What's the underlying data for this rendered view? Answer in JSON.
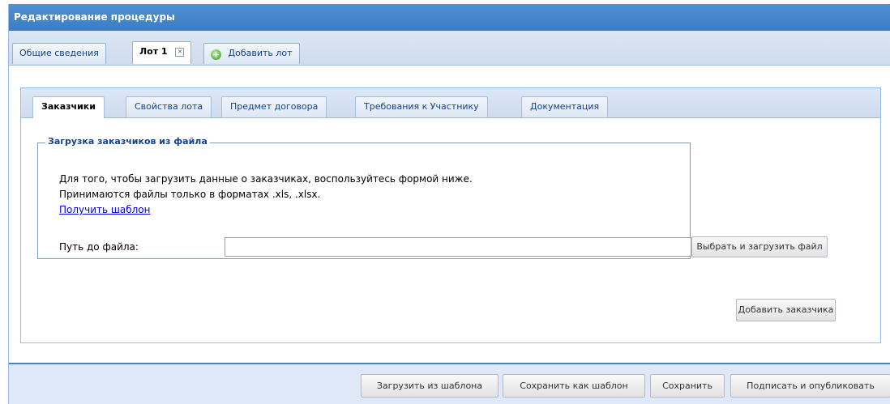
{
  "window": {
    "title": "Редактирование процедуры"
  },
  "top_tabs": [
    {
      "label": "Общие сведения"
    },
    {
      "label": "Лот 1"
    },
    {
      "label": "Добавить лот"
    }
  ],
  "inner_tabs": [
    {
      "label": "Заказчики"
    },
    {
      "label": "Свойства лота"
    },
    {
      "label": "Предмет договора"
    },
    {
      "label": "Требования к Участнику"
    },
    {
      "label": "Документация"
    }
  ],
  "upload": {
    "legend": "Загрузка заказчиков из файла",
    "line1": "Для того, чтобы загрузить данные о заказчиках, воспользуйтесь формой ниже.",
    "line2": "Принимаются файлы только в форматах .xls, .xlsx.",
    "template_link": "Получить шаблон",
    "path_label": "Путь до файла:",
    "path_value": "",
    "browse_button": "Выбрать и загрузить файл"
  },
  "add_customer_button": "Добавить заказчика",
  "footer": {
    "load_template": "Загрузить из шаблона",
    "save_as_template": "Сохранить как шаблон",
    "save": "Сохранить",
    "sign_publish": "Подписать и опубликовать"
  },
  "colors": {
    "title_bar": "#3c7cc1",
    "panel_bg": "#dfe8f6",
    "link": "#0000ee"
  }
}
